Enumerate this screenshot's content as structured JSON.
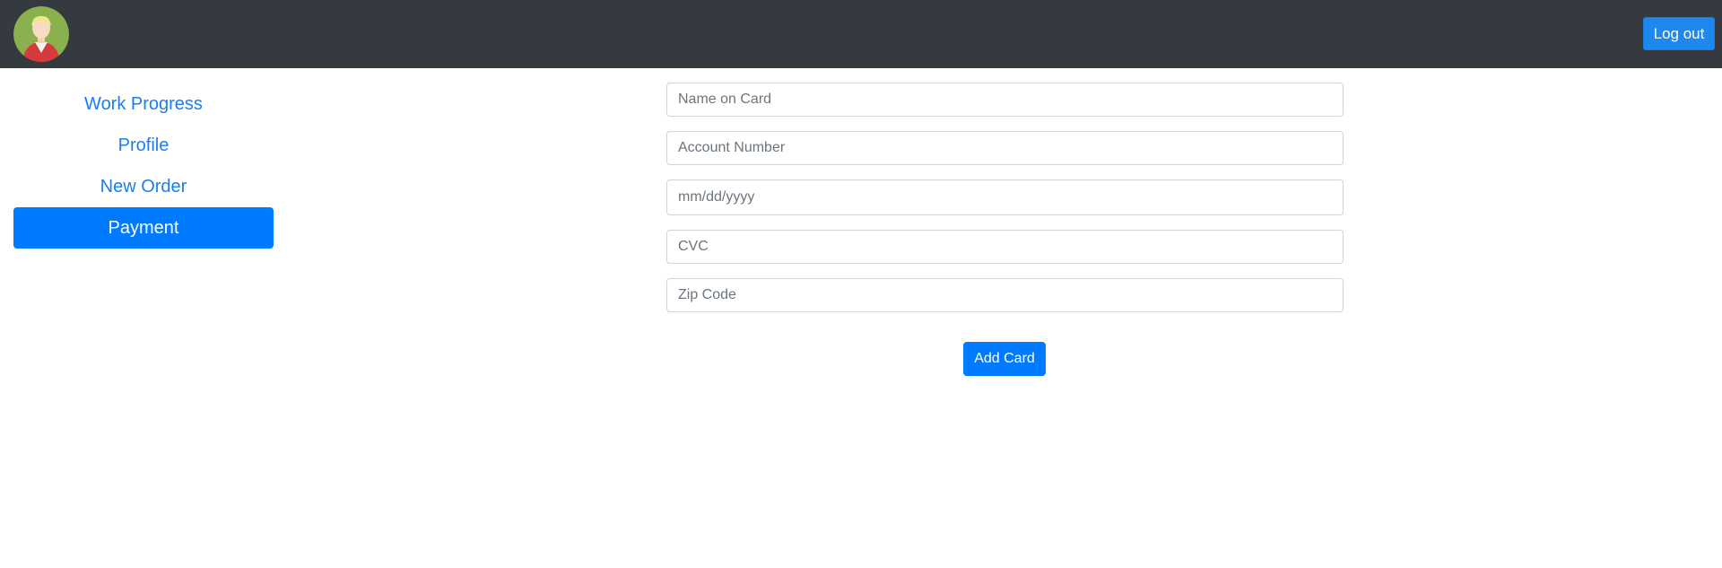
{
  "header": {
    "avatar_icon": "user-avatar-icon",
    "logout_label": "Log out",
    "background_color": "#343a40"
  },
  "sidebar": {
    "items": [
      {
        "label": "Work Progress",
        "active": false
      },
      {
        "label": "Profile",
        "active": false
      },
      {
        "label": "New Order",
        "active": false
      },
      {
        "label": "Payment",
        "active": true
      }
    ],
    "accent_color": "#007bff"
  },
  "payment_form": {
    "name_on_card": {
      "placeholder": "Name on Card",
      "value": ""
    },
    "account_number": {
      "placeholder": "Account Number",
      "value": ""
    },
    "expiry_date": {
      "placeholder": "mm/dd/yyyy",
      "value": ""
    },
    "cvc": {
      "placeholder": "CVC",
      "value": ""
    },
    "zip_code": {
      "placeholder": "Zip Code",
      "value": ""
    },
    "submit_label": "Add Card"
  }
}
